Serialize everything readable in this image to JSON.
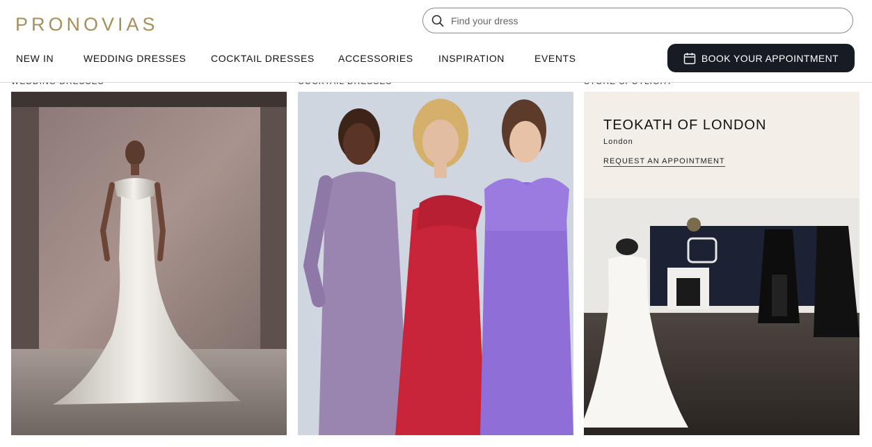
{
  "brand": {
    "logo_text": "PRONOVIAS",
    "accent": "#a88f5a"
  },
  "search": {
    "placeholder": "Find your dress",
    "icon": "search-icon"
  },
  "nav": {
    "items": [
      {
        "label": "NEW IN"
      },
      {
        "label": "WEDDING DRESSES"
      },
      {
        "label": "COCKTAIL DRESSES"
      },
      {
        "label": "ACCESSORIES"
      },
      {
        "label": "INSPIRATION"
      },
      {
        "label": "EVENTS"
      }
    ]
  },
  "cta": {
    "label": "BOOK YOUR APPOINTMENT",
    "icon": "calendar-icon",
    "color": "#161b24"
  },
  "columns": [
    {
      "label": "WEDDING DRESSES",
      "image": "bride-in-satin-mermaid-gown-photo"
    },
    {
      "label": "COCKTAIL DRESSES",
      "image": "three-models-in-cocktail-dresses-photo"
    },
    {
      "label": "STORE SPOTLIGHT",
      "image": "bridal-boutique-interior-photo"
    }
  ],
  "store": {
    "name": "TEOKATH OF LONDON",
    "city": "London",
    "link_label": "REQUEST AN APPOINTMENT"
  }
}
